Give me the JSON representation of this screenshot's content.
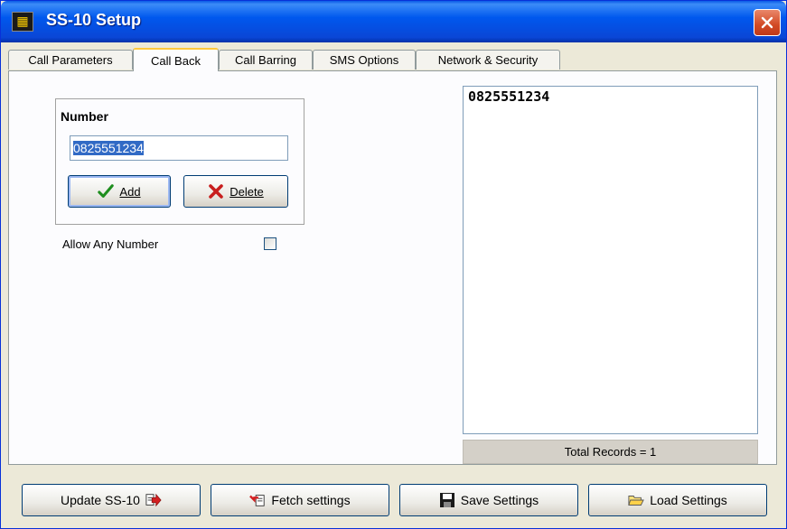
{
  "window": {
    "title": "SS-10 Setup",
    "app_icon": "grid-icon"
  },
  "tabs": [
    {
      "label": "Call Parameters"
    },
    {
      "label": "Call Back",
      "active": true
    },
    {
      "label": "Call Barring"
    },
    {
      "label": "SMS Options"
    },
    {
      "label": "Network & Security"
    }
  ],
  "callback": {
    "group_title": "Number",
    "number_value": "0825551234",
    "add_label": "Add",
    "delete_label": "Delete",
    "allow_any_label": "Allow Any Number",
    "allow_any_checked": false
  },
  "records": {
    "items": [
      "0825551234"
    ],
    "total_label": "Total Records = 1"
  },
  "footer": {
    "update_label": "Update SS-10",
    "fetch_label": "Fetch settings",
    "save_label": "Save Settings",
    "load_label": "Load Settings"
  },
  "colors": {
    "titlebar": "#0058ee",
    "accent_tab": "#ffc83c",
    "selection": "#316ac5",
    "close": "#d24a25"
  }
}
